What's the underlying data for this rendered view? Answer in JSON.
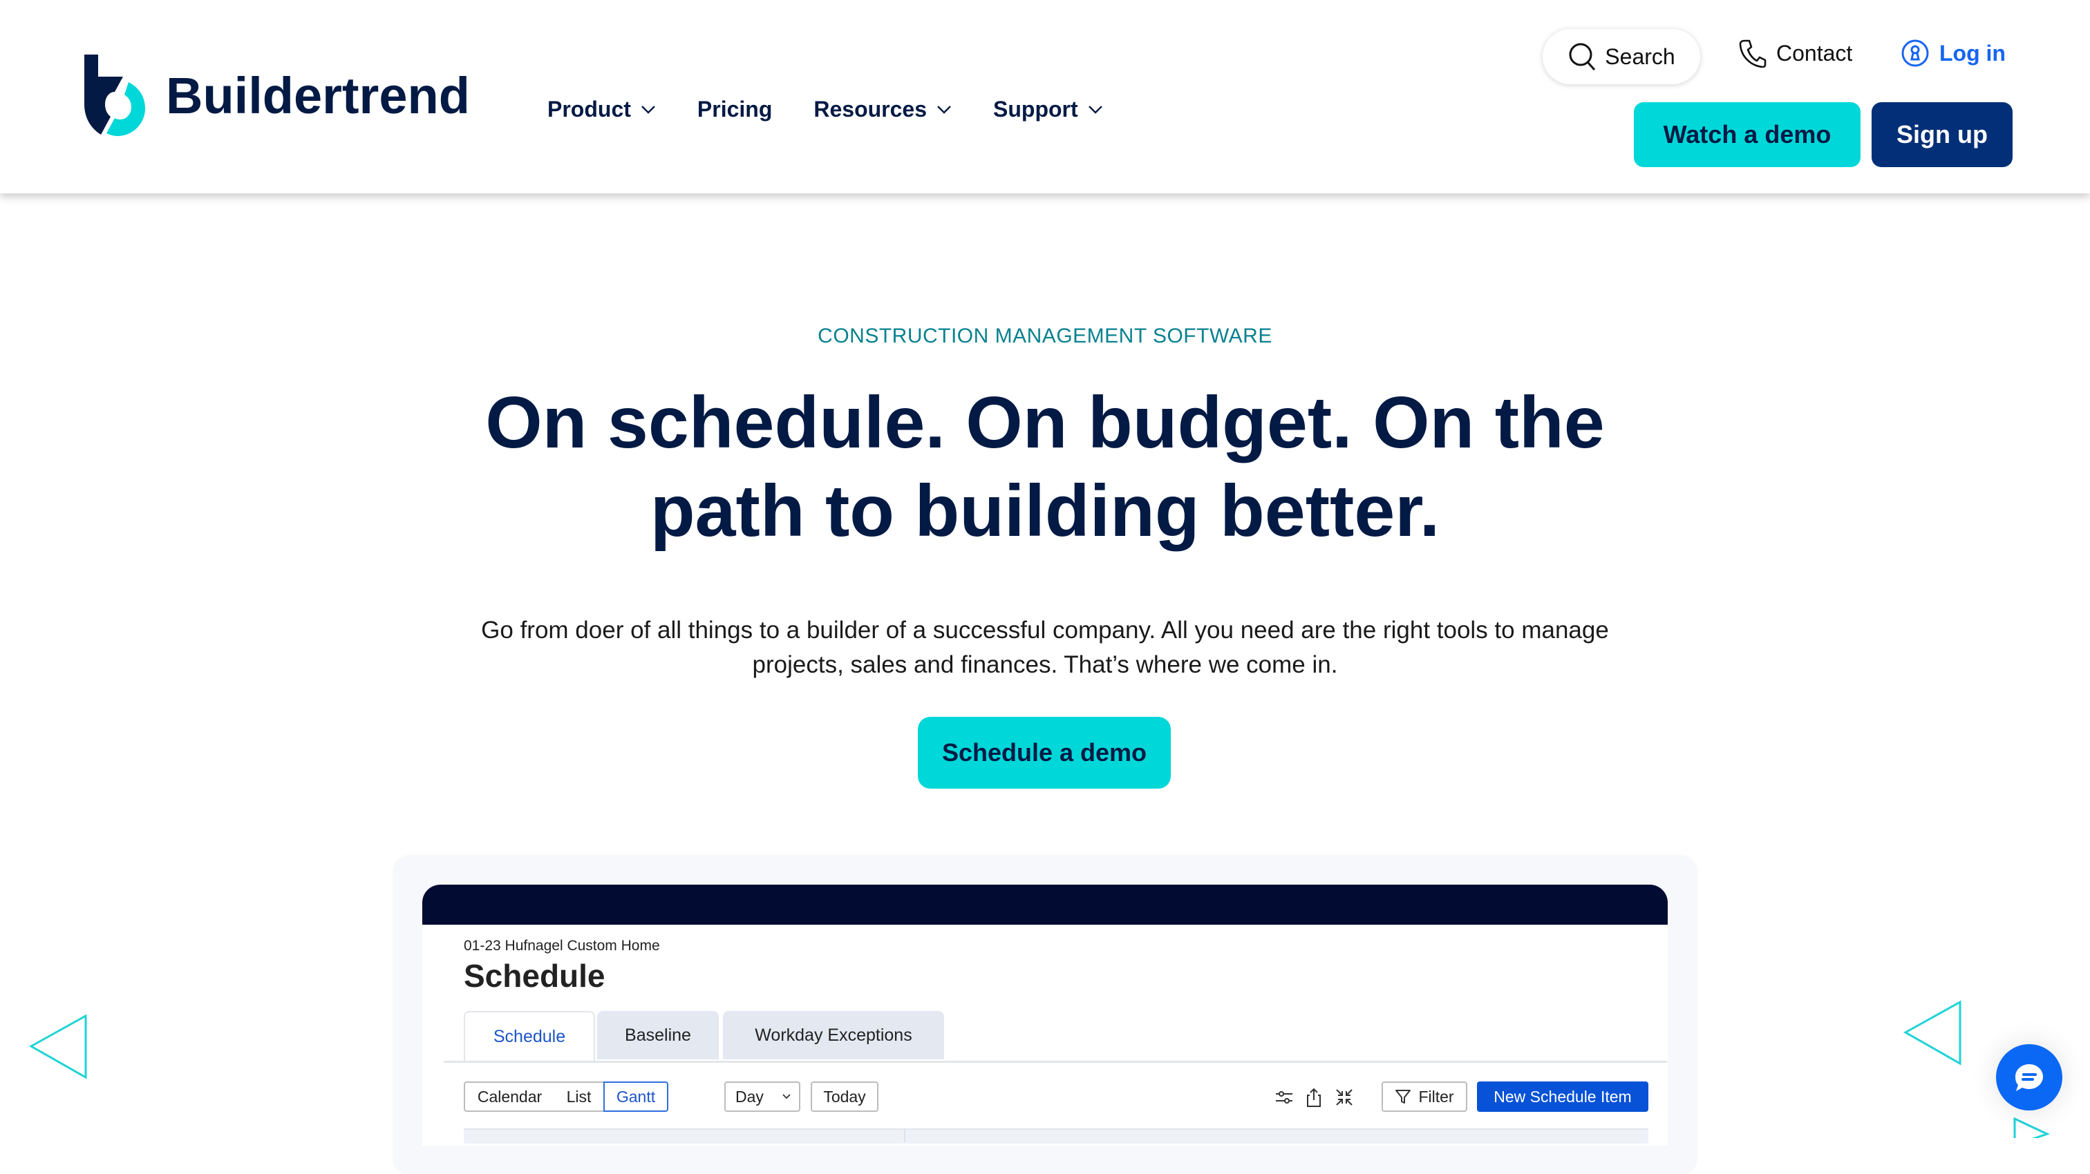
{
  "brand": {
    "name": "Buildertrend",
    "colors": {
      "navy": "#031a44",
      "teal": "#00d7d8",
      "blue": "#1665f0",
      "signup": "#022f77"
    }
  },
  "header": {
    "nav": [
      {
        "label": "Product",
        "has_dropdown": true
      },
      {
        "label": "Pricing",
        "has_dropdown": false
      },
      {
        "label": "Resources",
        "has_dropdown": true
      },
      {
        "label": "Support",
        "has_dropdown": true
      }
    ],
    "search_label": "Search",
    "contact_label": "Contact",
    "login_label": "Log in",
    "watch_demo_label": "Watch a demo",
    "signup_label": "Sign up"
  },
  "hero": {
    "eyebrow": "CONSTRUCTION MANAGEMENT SOFTWARE",
    "headline_line1": "On schedule. On budget. On the",
    "headline_line2": "path to building better.",
    "subtext_line1": "Go from doer of all things to a builder of a successful company. All you need are the right tools to manage",
    "subtext_line2": "projects, sales and finances. That’s where we come in.",
    "cta_label": "Schedule a demo"
  },
  "app_preview": {
    "breadcrumb": "01-23 Hufnagel Custom Home",
    "title": "Schedule",
    "tabs": [
      {
        "label": "Schedule",
        "active": true
      },
      {
        "label": "Baseline",
        "active": false
      },
      {
        "label": "Workday Exceptions",
        "active": false
      }
    ],
    "view_toggle": [
      {
        "label": "Calendar",
        "active": false
      },
      {
        "label": "List",
        "active": false
      },
      {
        "label": "Gantt",
        "active": true
      }
    ],
    "zoom_select": "Day",
    "today_label": "Today",
    "toolbar_icons": [
      "sliders-icon",
      "share-icon",
      "collapse-icon"
    ],
    "filter_label": "Filter",
    "new_item_label": "New Schedule Item"
  },
  "chat": {
    "icon": "chat-bubble-icon"
  }
}
